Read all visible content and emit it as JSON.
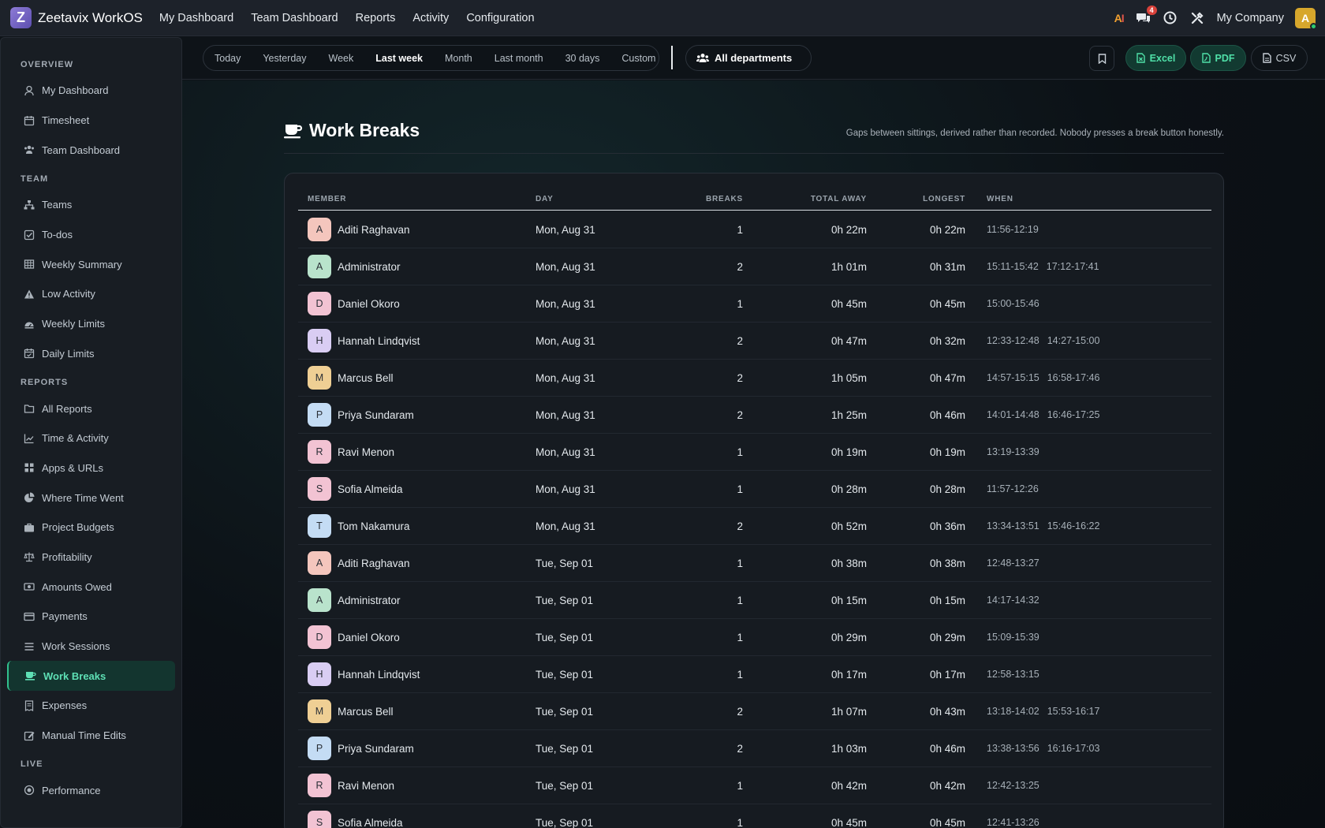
{
  "app": {
    "logo_letter": "Z",
    "name": "Zeetavix WorkOS"
  },
  "topnav": [
    "My Dashboard",
    "Team Dashboard",
    "Reports",
    "Activity",
    "Configuration"
  ],
  "topbar": {
    "ai_label_a": "A",
    "ai_label_i": "I",
    "notifications": "4",
    "company": "My Company",
    "user_initial": "A"
  },
  "sidebar": {
    "sections": [
      {
        "title": "OVERVIEW",
        "items": [
          {
            "label": "My Dashboard",
            "icon": "user-icon"
          },
          {
            "label": "Timesheet",
            "icon": "calendar-icon"
          },
          {
            "label": "Team Dashboard",
            "icon": "users-icon"
          }
        ]
      },
      {
        "title": "TEAM",
        "items": [
          {
            "label": "Teams",
            "icon": "sitemap-icon"
          },
          {
            "label": "To-dos",
            "icon": "checkbox-icon"
          },
          {
            "label": "Weekly Summary",
            "icon": "table-icon"
          },
          {
            "label": "Low Activity",
            "icon": "warning-icon"
          },
          {
            "label": "Weekly Limits",
            "icon": "gauge-icon"
          },
          {
            "label": "Daily Limits",
            "icon": "calendar-check-icon"
          }
        ]
      },
      {
        "title": "REPORTS",
        "items": [
          {
            "label": "All Reports",
            "icon": "folder-icon"
          },
          {
            "label": "Time & Activity",
            "icon": "line-chart-icon"
          },
          {
            "label": "Apps & URLs",
            "icon": "grid-icon"
          },
          {
            "label": "Where Time Went",
            "icon": "pie-chart-icon"
          },
          {
            "label": "Project Budgets",
            "icon": "briefcase-icon"
          },
          {
            "label": "Profitability",
            "icon": "scale-icon"
          },
          {
            "label": "Amounts Owed",
            "icon": "money-icon"
          },
          {
            "label": "Payments",
            "icon": "credit-card-icon"
          },
          {
            "label": "Work Sessions",
            "icon": "list-icon"
          },
          {
            "label": "Work Breaks",
            "icon": "coffee-icon",
            "active": true
          },
          {
            "label": "Expenses",
            "icon": "receipt-icon"
          },
          {
            "label": "Manual Time Edits",
            "icon": "edit-icon"
          }
        ]
      },
      {
        "title": "LIVE",
        "items": [
          {
            "label": "Performance",
            "icon": "target-icon"
          }
        ]
      }
    ]
  },
  "toolbar": {
    "ranges": [
      "Today",
      "Yesterday",
      "Week",
      "Last week",
      "Month",
      "Last month",
      "30 days",
      "Custom"
    ],
    "active_range": "Last week",
    "department": "All departments",
    "export_excel": "Excel",
    "export_pdf": "PDF",
    "export_csv": "CSV"
  },
  "page": {
    "title": "Work Breaks",
    "subtitle": "Gaps between sittings, derived rather than recorded. Nobody presses a break button honestly."
  },
  "table": {
    "columns": [
      "MEMBER",
      "DAY",
      "BREAKS",
      "TOTAL AWAY",
      "LONGEST",
      "WHEN"
    ],
    "rows": [
      {
        "initial": "A",
        "color": "#f4c6bd",
        "member": "Aditi Raghavan",
        "day": "Mon, Aug 31",
        "breaks": "1",
        "total": "0h 22m",
        "longest": "0h 22m",
        "when": [
          "11:56-12:19"
        ]
      },
      {
        "initial": "A",
        "color": "#b9e3cc",
        "member": "Administrator",
        "day": "Mon, Aug 31",
        "breaks": "2",
        "total": "1h 01m",
        "longest": "0h 31m",
        "when": [
          "15:11-15:42",
          "17:12-17:41"
        ]
      },
      {
        "initial": "D",
        "color": "#f2c3d3",
        "member": "Daniel Okoro",
        "day": "Mon, Aug 31",
        "breaks": "1",
        "total": "0h 45m",
        "longest": "0h 45m",
        "when": [
          "15:00-15:46"
        ]
      },
      {
        "initial": "H",
        "color": "#d9cdf3",
        "member": "Hannah Lindqvist",
        "day": "Mon, Aug 31",
        "breaks": "2",
        "total": "0h 47m",
        "longest": "0h 32m",
        "when": [
          "12:33-12:48",
          "14:27-15:00"
        ]
      },
      {
        "initial": "M",
        "color": "#efcf94",
        "member": "Marcus Bell",
        "day": "Mon, Aug 31",
        "breaks": "2",
        "total": "1h 05m",
        "longest": "0h 47m",
        "when": [
          "14:57-15:15",
          "16:58-17:46"
        ]
      },
      {
        "initial": "P",
        "color": "#c4dcf4",
        "member": "Priya Sundaram",
        "day": "Mon, Aug 31",
        "breaks": "2",
        "total": "1h 25m",
        "longest": "0h 46m",
        "when": [
          "14:01-14:48",
          "16:46-17:25"
        ]
      },
      {
        "initial": "R",
        "color": "#f2c3d3",
        "member": "Ravi Menon",
        "day": "Mon, Aug 31",
        "breaks": "1",
        "total": "0h 19m",
        "longest": "0h 19m",
        "when": [
          "13:19-13:39"
        ]
      },
      {
        "initial": "S",
        "color": "#f2c3d3",
        "member": "Sofia Almeida",
        "day": "Mon, Aug 31",
        "breaks": "1",
        "total": "0h 28m",
        "longest": "0h 28m",
        "when": [
          "11:57-12:26"
        ]
      },
      {
        "initial": "T",
        "color": "#c4dcf4",
        "member": "Tom Nakamura",
        "day": "Mon, Aug 31",
        "breaks": "2",
        "total": "0h 52m",
        "longest": "0h 36m",
        "when": [
          "13:34-13:51",
          "15:46-16:22"
        ]
      },
      {
        "initial": "A",
        "color": "#f4c6bd",
        "member": "Aditi Raghavan",
        "day": "Tue, Sep 01",
        "breaks": "1",
        "total": "0h 38m",
        "longest": "0h 38m",
        "when": [
          "12:48-13:27"
        ]
      },
      {
        "initial": "A",
        "color": "#b9e3cc",
        "member": "Administrator",
        "day": "Tue, Sep 01",
        "breaks": "1",
        "total": "0h 15m",
        "longest": "0h 15m",
        "when": [
          "14:17-14:32"
        ]
      },
      {
        "initial": "D",
        "color": "#f2c3d3",
        "member": "Daniel Okoro",
        "day": "Tue, Sep 01",
        "breaks": "1",
        "total": "0h 29m",
        "longest": "0h 29m",
        "when": [
          "15:09-15:39"
        ]
      },
      {
        "initial": "H",
        "color": "#d9cdf3",
        "member": "Hannah Lindqvist",
        "day": "Tue, Sep 01",
        "breaks": "1",
        "total": "0h 17m",
        "longest": "0h 17m",
        "when": [
          "12:58-13:15"
        ]
      },
      {
        "initial": "M",
        "color": "#efcf94",
        "member": "Marcus Bell",
        "day": "Tue, Sep 01",
        "breaks": "2",
        "total": "1h 07m",
        "longest": "0h 43m",
        "when": [
          "13:18-14:02",
          "15:53-16:17"
        ]
      },
      {
        "initial": "P",
        "color": "#c4dcf4",
        "member": "Priya Sundaram",
        "day": "Tue, Sep 01",
        "breaks": "2",
        "total": "1h 03m",
        "longest": "0h 46m",
        "when": [
          "13:38-13:56",
          "16:16-17:03"
        ]
      },
      {
        "initial": "R",
        "color": "#f2c3d3",
        "member": "Ravi Menon",
        "day": "Tue, Sep 01",
        "breaks": "1",
        "total": "0h 42m",
        "longest": "0h 42m",
        "when": [
          "12:42-13:25"
        ]
      },
      {
        "initial": "S",
        "color": "#f2c3d3",
        "member": "Sofia Almeida",
        "day": "Tue, Sep 01",
        "breaks": "1",
        "total": "0h 45m",
        "longest": "0h 45m",
        "when": [
          "12:41-13:26"
        ]
      }
    ]
  }
}
